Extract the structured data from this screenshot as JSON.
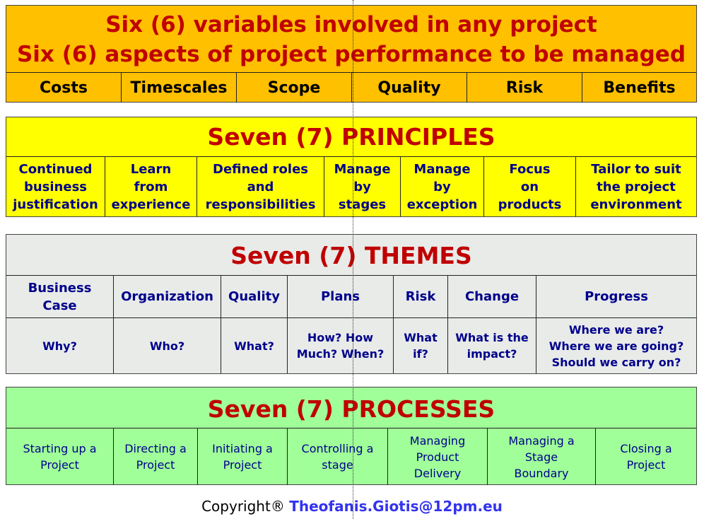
{
  "variables": {
    "title_line1": "Six (6) variables involved in any project",
    "title_line2": "Six (6) aspects of project performance to be managed",
    "items": [
      "Costs",
      "Timescales",
      "Scope",
      "Quality",
      "Risk",
      "Benefits"
    ],
    "bg_color": "#ffc000"
  },
  "principles": {
    "title": "Seven (7) PRINCIPLES",
    "items": [
      "Continued\nbusiness\njustification",
      "Learn\nfrom\nexperience",
      "Defined roles\nand\nresponsibilities",
      "Manage\nby\nstages",
      "Manage\nby\nexception",
      "Focus\non\nproducts",
      "Tailor to suit\nthe project\nenvironment"
    ],
    "bg_color": "#ffff00"
  },
  "themes": {
    "title": "Seven (7) THEMES",
    "items": [
      {
        "name": "Business\nCase",
        "question": "Why?"
      },
      {
        "name": "Organization",
        "question": "Who?"
      },
      {
        "name": "Quality",
        "question": "What?"
      },
      {
        "name": "Plans",
        "question": "How? How\nMuch? When?"
      },
      {
        "name": "Risk",
        "question": "What\nif?"
      },
      {
        "name": "Change",
        "question": "What is the\nimpact?"
      },
      {
        "name": "Progress",
        "question": "Where we are?\nWhere we are going?\nShould we carry on?"
      }
    ],
    "bg_color": "#e8ebe8"
  },
  "processes": {
    "title": "Seven (7) PROCESSES",
    "items": [
      "Starting up a\nProject",
      "Directing a\nProject",
      "Initiating a\nProject",
      "Controlling a\nstage",
      "Managing\nProduct\nDelivery",
      "Managing a\nStage\nBoundary",
      "Closing a\nProject"
    ],
    "bg_color": "#a0ff98"
  },
  "footer": {
    "copyright": "Copyright®",
    "email": "Theofanis.Giotis@12pm.eu"
  },
  "colors": {
    "title_red": "#c00000",
    "text_navy": "#00008b",
    "email_blue": "#3333ee"
  }
}
